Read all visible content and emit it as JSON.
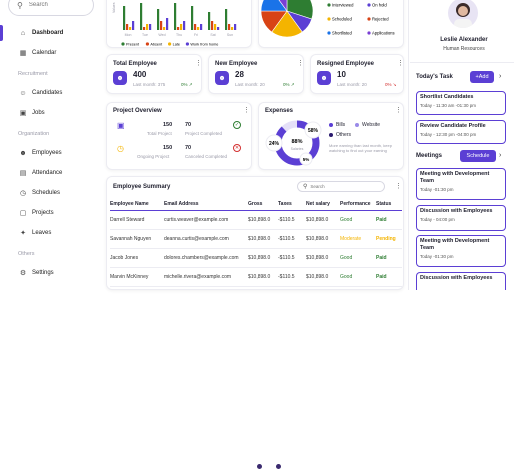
{
  "sidebar": {
    "search_placeholder": "Search",
    "items": [
      {
        "label": "Dashboard",
        "icon": "home-icon",
        "glyph": "⌂"
      },
      {
        "label": "Calendar",
        "icon": "calendar-icon",
        "glyph": "▦"
      },
      {
        "label": "Candidates",
        "icon": "users-icon",
        "glyph": "☺"
      },
      {
        "label": "Jobs",
        "icon": "briefcase-icon",
        "glyph": "▣"
      },
      {
        "label": "Employees",
        "icon": "people-icon",
        "glyph": "☻"
      },
      {
        "label": "Attendance",
        "icon": "chart-icon",
        "glyph": "▤"
      },
      {
        "label": "Schedules",
        "icon": "clock-icon",
        "glyph": "◷"
      },
      {
        "label": "Projects",
        "icon": "folder-icon",
        "glyph": "▢"
      },
      {
        "label": "Leaves",
        "icon": "sparkle-icon",
        "glyph": "✦"
      },
      {
        "label": "Settings",
        "icon": "gear-icon",
        "glyph": "⚙"
      }
    ],
    "sections": {
      "recruitment": "Recruitment",
      "organization": "Organization",
      "others": "Others"
    }
  },
  "attendance_chart": {
    "days": [
      "Mon",
      "Tue",
      "Wed",
      "Thu",
      "Fri",
      "Sat",
      "Sun"
    ],
    "legend": [
      {
        "label": "Present",
        "color": "#2e7d32"
      },
      {
        "label": "Absent",
        "color": "#d84315"
      },
      {
        "label": "Late",
        "color": "#f4b400"
      },
      {
        "label": "Work from home",
        "color": "#5b3fd4"
      }
    ],
    "y_label": "Values",
    "series": {
      "present": [
        8,
        9,
        7,
        9,
        8,
        6,
        7
      ],
      "absent": [
        2,
        1,
        3,
        1,
        2,
        3,
        2
      ],
      "late": [
        1,
        2,
        1,
        2,
        1,
        2,
        1
      ],
      "wfh": [
        3,
        2,
        4,
        3,
        2,
        1,
        2
      ]
    }
  },
  "pie_chart": {
    "slices": [
      {
        "label": "Interviewed",
        "value": 30,
        "color": "#2e7d32"
      },
      {
        "label": "On hold",
        "value": 10,
        "color": "#5b3fd4"
      },
      {
        "label": "Scheduled",
        "value": 20,
        "color": "#f4b400"
      },
      {
        "label": "Rejected",
        "value": 15,
        "color": "#d84315"
      },
      {
        "label": "Shortlisted",
        "value": 15,
        "color": "#1a73e8"
      },
      {
        "label": "Applications",
        "value": 10,
        "color": "#7a3fd4"
      }
    ]
  },
  "stats": [
    {
      "title": "Total Employee",
      "value": "400",
      "sub": "Last month: 375",
      "pct": "0%",
      "pct_color": "#2e7d32",
      "trend": "↗"
    },
    {
      "title": "New Employee",
      "value": "28",
      "sub": "Last month: 20",
      "pct": "0%",
      "pct_color": "#2e7d32",
      "trend": "↗"
    },
    {
      "title": "Resigned Employee",
      "value": "10",
      "sub": "Last month: 20",
      "pct": "0%",
      "pct_color": "#d32f2f",
      "trend": "↘"
    }
  ],
  "project_overview": {
    "title": "Project Overview",
    "total_project": {
      "value": "150",
      "label": "Total Project"
    },
    "completed": {
      "value": "70",
      "label": "Project Completed"
    },
    "ongoing": {
      "value": "150",
      "label": "Ongoing Project"
    },
    "cancelled": {
      "value": "70",
      "label": "Canceled Completed"
    }
  },
  "expenses": {
    "title": "Expenses",
    "rings": {
      "outer": "24%",
      "main": "88%",
      "main_sub": "Salaries",
      "top": "58%",
      "bottom": "5%"
    },
    "legend": [
      "Bills",
      "Website",
      "Others"
    ],
    "note": "More earning than last month, keep watching to find out your earning"
  },
  "employee_summary": {
    "title": "Employee Summary",
    "search_placeholder": "Search",
    "columns": [
      "Employee Name",
      "Email Address",
      "Gross",
      "Taxes",
      "Net salary",
      "Performance",
      "Status"
    ],
    "rows": [
      {
        "name": "Darrell Steward",
        "email": "curtis.weaver@example.com",
        "gross": "$10,898.0",
        "taxes": "-$110.5",
        "net": "$10,898.0",
        "performance": "Good",
        "perf_color": "#2e7d32",
        "status": "Paid",
        "status_color": "#2e7d32"
      },
      {
        "name": "Savannah Nguyen",
        "email": "deanna.curtis@example.com",
        "gross": "$10,898.0",
        "taxes": "-$110.5",
        "net": "$10,898.0",
        "performance": "Moderate",
        "perf_color": "#f4b400",
        "status": "Pending",
        "status_color": "#f4b400"
      },
      {
        "name": "Jacob Jones",
        "email": "dolores.chambers@example.com",
        "gross": "$10,898.0",
        "taxes": "-$110.5",
        "net": "$10,898.0",
        "performance": "Good",
        "perf_color": "#2e7d32",
        "status": "Paid",
        "status_color": "#2e7d32"
      },
      {
        "name": "Marvin McKinney",
        "email": "michelle.rivera@example.com",
        "gross": "$10,898.0",
        "taxes": "-$110.5",
        "net": "$10,898.0",
        "performance": "Good",
        "perf_color": "#2e7d32",
        "status": "Paid",
        "status_color": "#2e7d32"
      }
    ]
  },
  "profile": {
    "name": "Leslie Alexander",
    "role": "Human Resources"
  },
  "tasks": {
    "title": "Today's Task",
    "add_label": "+Add",
    "items": [
      {
        "title": "Shortlist Candidates",
        "time": "Today - 11:30 am -01:30 pm"
      },
      {
        "title": "Review Candidate Profile",
        "time": "Today - 12:30 pm -04:00 pm"
      }
    ]
  },
  "meetings": {
    "title": "Meetings",
    "schedule_label": "Schedule",
    "items": [
      {
        "title": "Meeting with Development Team",
        "time": "Today -01:30 pm"
      },
      {
        "title": "Discussion with Employees",
        "time": "Today - 04:00 pm"
      },
      {
        "title": "Meeting with Development Team",
        "time": "Today -01:30 pm"
      },
      {
        "title": "Discussion with Employees",
        "time": ""
      }
    ]
  },
  "colors": {
    "accent": "#5b3fd4",
    "green": "#2e7d32",
    "red": "#d32f2f",
    "amber": "#f4b400"
  }
}
